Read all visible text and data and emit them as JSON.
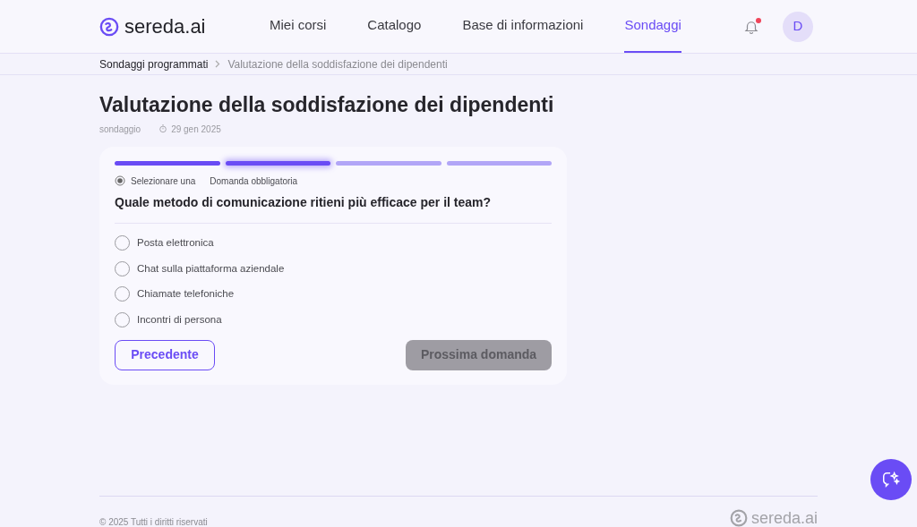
{
  "header": {
    "logo": "sereda.ai",
    "nav": [
      {
        "label": "Miei corsi",
        "selected": false
      },
      {
        "label": "Catalogo",
        "selected": false
      },
      {
        "label": "Base di informazioni",
        "selected": false
      },
      {
        "label": "Sondaggi",
        "selected": true
      }
    ],
    "notification_unread": true,
    "avatar": "D"
  },
  "breadcrumb": [
    "Sondaggi programmati",
    "Valutazione della soddisfazione dei dipendenti"
  ],
  "page": {
    "title": "Valutazione della soddisfazione dei dipendenti",
    "type": "sondaggio",
    "date": "29 gen 2025"
  },
  "progress": [
    {
      "kind": "done"
    },
    {
      "kind": "current"
    },
    {
      "kind": "pending"
    },
    {
      "kind": "pending"
    }
  ],
  "question": {
    "mode": "Selezionare una",
    "required": "Domanda obbligatoria",
    "text": "Quale metodo di comunicazione ritieni più efficace per il team?",
    "options": [
      {
        "label": "Posta elettronica",
        "selected": false
      },
      {
        "label": "Chat sulla piattaforma aziendale",
        "selected": false
      },
      {
        "label": "Chiamate telefoniche",
        "selected": false
      },
      {
        "label": "Incontri di persona",
        "selected": false
      }
    ]
  },
  "buttons": {
    "previous": "Precedente",
    "next": {
      "label": "Prossima domanda",
      "disabled": true
    }
  },
  "footer": {
    "copyright": "© 2025 Tutti i diritti riservati",
    "logo": "sereda.ai"
  }
}
